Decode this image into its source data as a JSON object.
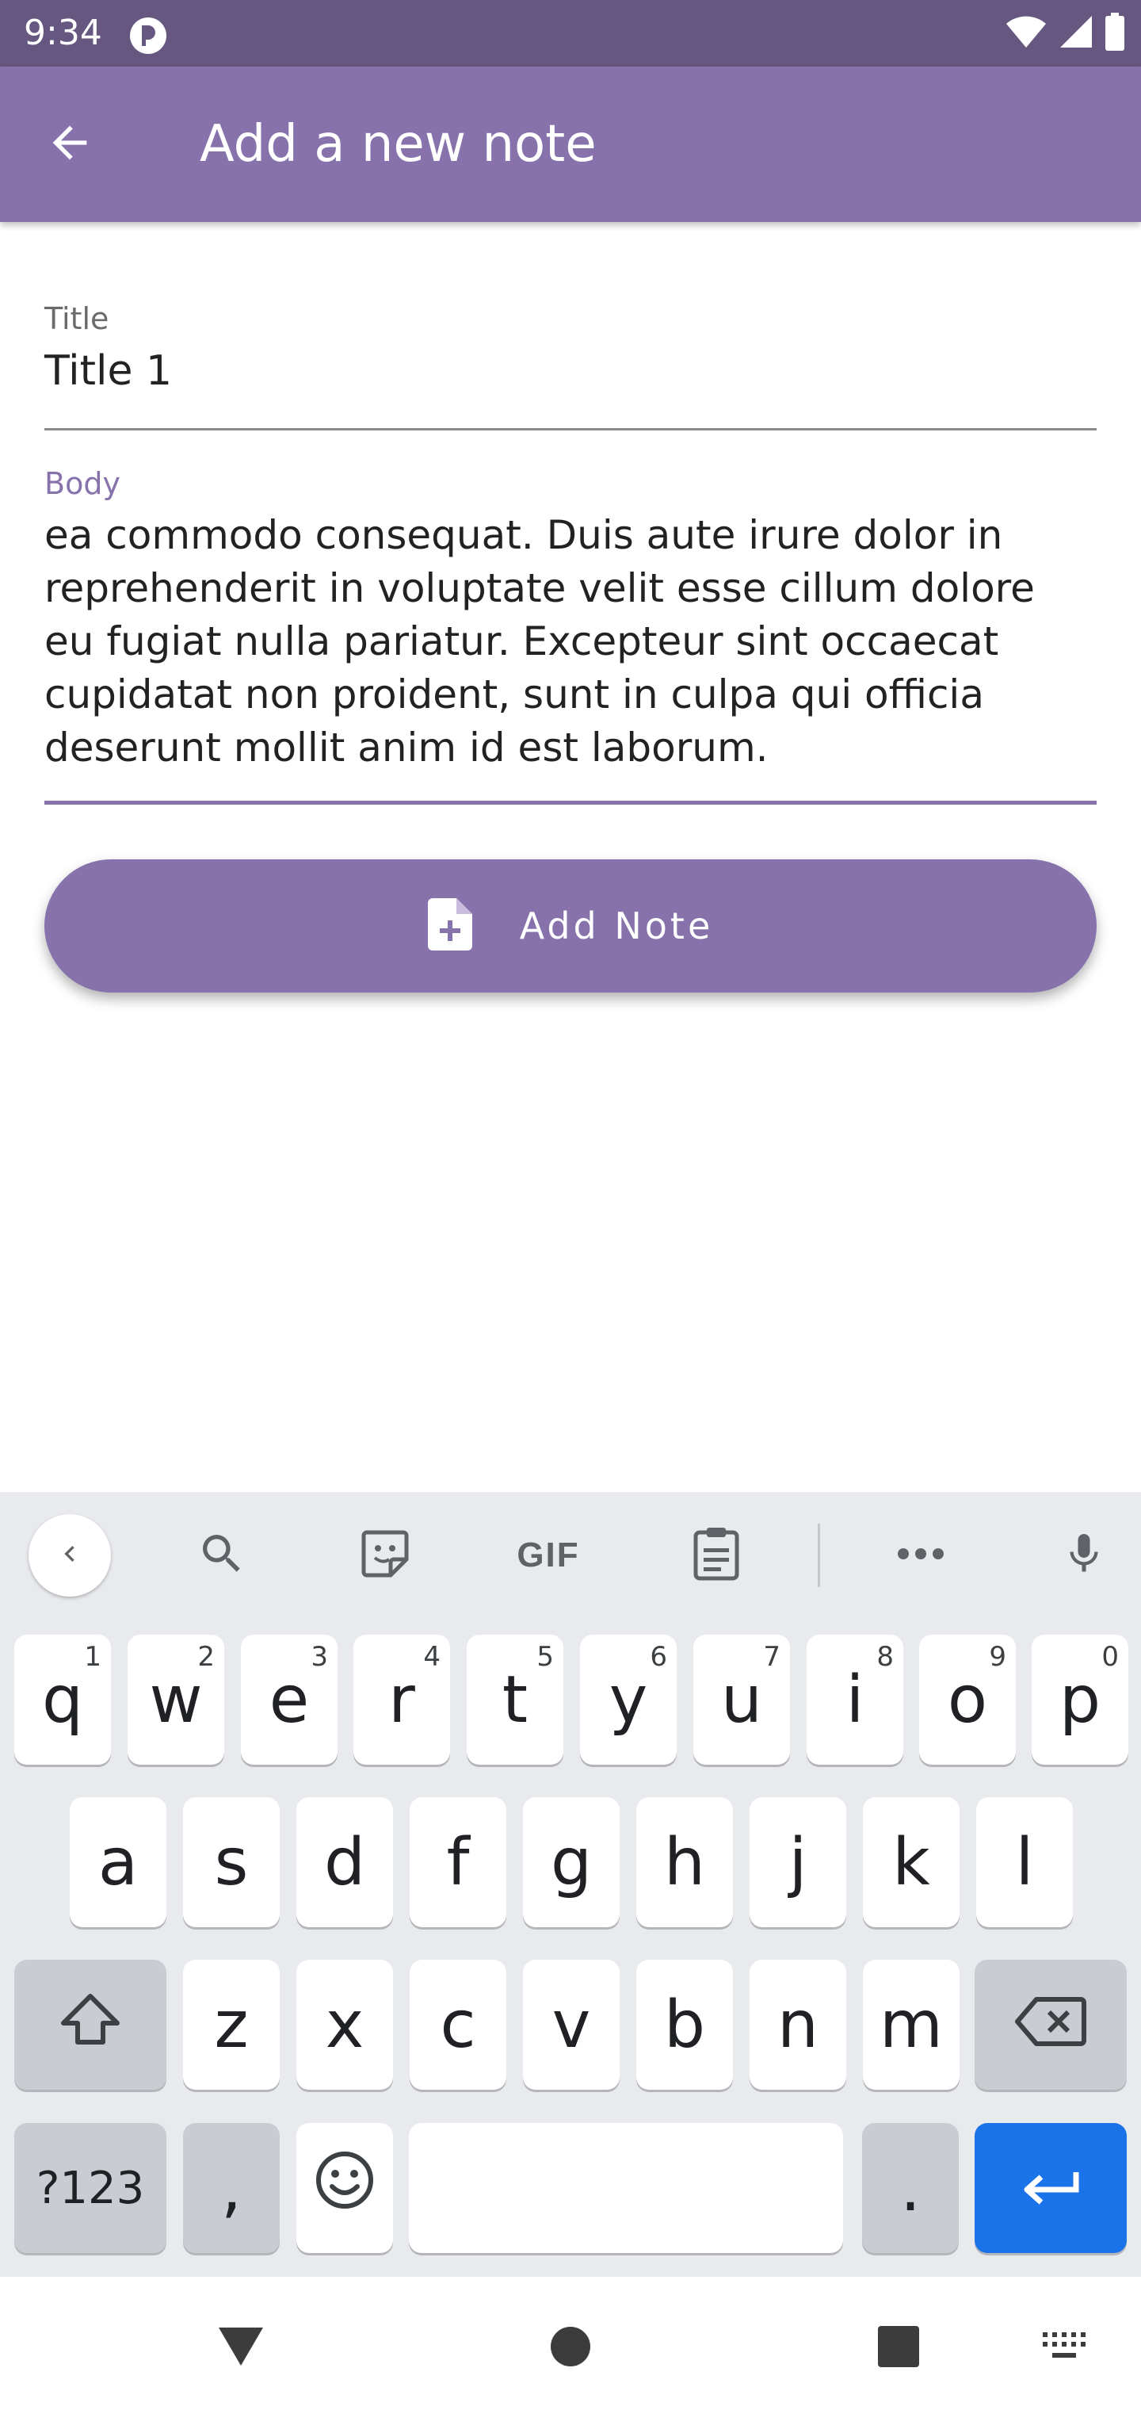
{
  "status_bar": {
    "time": "9:34"
  },
  "app_bar": {
    "title": "Add a new note",
    "back_icon": "arrow-back-icon"
  },
  "form": {
    "title_label": "Title",
    "title_value": "Title 1",
    "body_label": "Body",
    "body_value": "ea commodo consequat. Duis aute irure dolor in reprehenderit in voluptate velit esse cillum dolore eu fugiat nulla pariatur. Excepteur sint occaecat cupidatat non proident, sunt in culpa qui officia deserunt mollit anim id est laborum.",
    "add_button_label": "Add Note",
    "add_button_icon": "note-add-icon"
  },
  "keyboard": {
    "toolbar": [
      "chevron-left-icon",
      "search-icon",
      "sticker-icon",
      "gif-icon",
      "clipboard-icon",
      "more-icon",
      "mic-icon"
    ],
    "gif_label": "GIF",
    "row1": [
      {
        "k": "q",
        "h": "1"
      },
      {
        "k": "w",
        "h": "2"
      },
      {
        "k": "e",
        "h": "3"
      },
      {
        "k": "r",
        "h": "4"
      },
      {
        "k": "t",
        "h": "5"
      },
      {
        "k": "y",
        "h": "6"
      },
      {
        "k": "u",
        "h": "7"
      },
      {
        "k": "i",
        "h": "8"
      },
      {
        "k": "o",
        "h": "9"
      },
      {
        "k": "p",
        "h": "0"
      }
    ],
    "row2": [
      "a",
      "s",
      "d",
      "f",
      "g",
      "h",
      "j",
      "k",
      "l"
    ],
    "row3": [
      "z",
      "x",
      "c",
      "v",
      "b",
      "n",
      "m"
    ],
    "symbols_label": "?123",
    "comma_label": ",",
    "period_label": "."
  },
  "colors": {
    "status_bar": "#65577f",
    "primary": "#8772ab",
    "keyboard_bg": "#e8eaed",
    "enter_key": "#1a73e8"
  }
}
